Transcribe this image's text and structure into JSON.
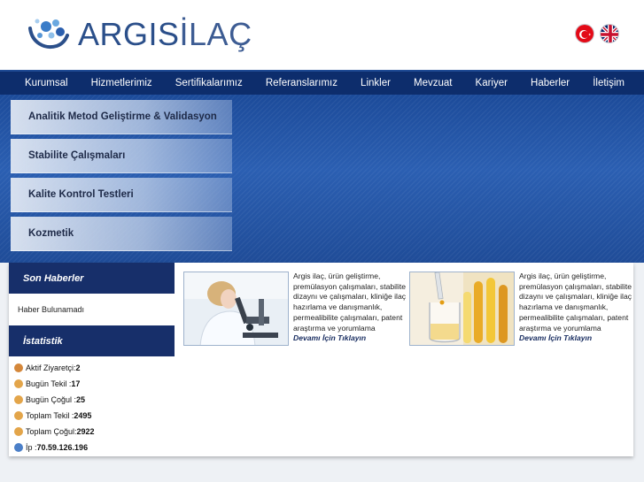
{
  "brand": {
    "name_bold": "ARGIS",
    "name_light": "İLAÇ"
  },
  "flags": [
    {
      "icon": "turkey-flag-icon"
    },
    {
      "icon": "uk-flag-icon"
    }
  ],
  "nav": {
    "items": [
      "Kurumsal",
      "Hizmetlerimiz",
      "Sertifikalarımız",
      "Referanslarımız",
      "Linkler",
      "Mevzuat",
      "Kariyer",
      "Haberler",
      "İletişim"
    ]
  },
  "banner": {
    "services": [
      "Analitik Metod Geliştirme & Validasyon",
      "Stabilite Çalışmaları",
      "Kalite Kontrol Testleri",
      "Kozmetik"
    ]
  },
  "sidebar": {
    "news_title": "Son Haberler",
    "news_empty": "Haber Bulunamadı",
    "stats_title": "İstatistik",
    "stats": [
      {
        "label": "Aktif Ziyaretçi: ",
        "value": "2",
        "icon": "users-online-icon",
        "color": "#d4873a"
      },
      {
        "label": "Bugün Tekil :",
        "value": "17",
        "icon": "user-icon",
        "color": "#e3a54a"
      },
      {
        "label": "Bugün Çoğul :",
        "value": "25",
        "icon": "users-icon",
        "color": "#e3a54a"
      },
      {
        "label": "Toplam Tekil :",
        "value": "2495",
        "icon": "group-icon",
        "color": "#e3a54a"
      },
      {
        "label": "Toplam Çoğul:",
        "value": "2922",
        "icon": "group-icon",
        "color": "#e3a54a"
      },
      {
        "label": "İp : ",
        "value": "70.59.126.196",
        "icon": "globe-icon",
        "color": "#4b7fc8"
      }
    ]
  },
  "cards": [
    {
      "text": "Argis ilaç, ürün geliştirme, premülasyon çalışmaları, stabilite dizaynı ve çalışmaları, kliniğe ilaç hazırlama ve danışmanlık, permealibilite çalışmaları, patent araştırma ve yorumlama",
      "more": "Devamı İçin Tıklayın",
      "image": "scientist-microscope-image"
    },
    {
      "text": "Argis ilaç, ürün geliştirme, premülasyon çalışmaları, stabilite dizaynı ve çalışmaları, kliniğe ilaç hazırlama ve danışmanlık, permealibilite çalışmaları, patent araştırma ve yorumlama",
      "more": "Devamı İçin Tıklayın",
      "image": "test-tubes-image"
    }
  ]
}
